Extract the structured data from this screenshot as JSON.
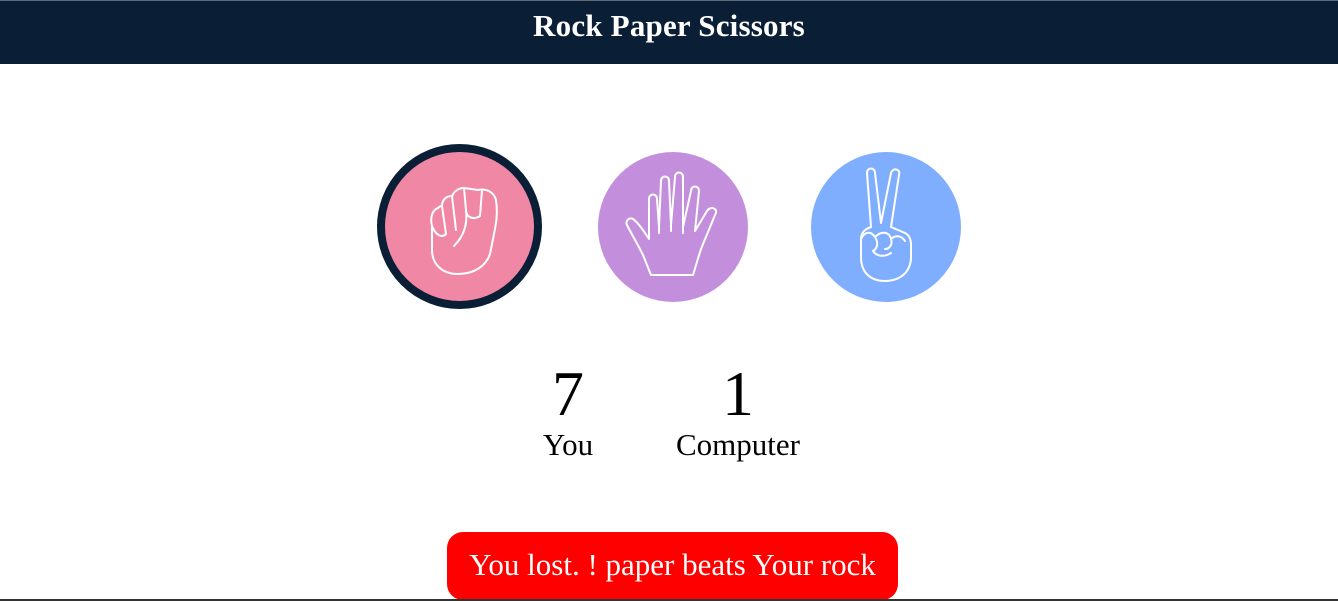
{
  "header": {
    "title": "Rock Paper Scissors"
  },
  "choices": [
    {
      "id": "rock",
      "icon": "fist-icon",
      "color": "#f087a4",
      "selected": true
    },
    {
      "id": "paper",
      "icon": "open-hand-icon",
      "color": "#c38fdd",
      "selected": false
    },
    {
      "id": "scissors",
      "icon": "peace-sign-hand-icon",
      "color": "#80aeff",
      "selected": false
    }
  ],
  "selected_border_color": "#0a1f35",
  "scoreboard": {
    "user": {
      "value": "7",
      "label": "You"
    },
    "computer": {
      "value": "1",
      "label": "Computer"
    }
  },
  "result": {
    "message": "You lost. ! paper beats Your rock",
    "background_color": "#ff0000"
  }
}
